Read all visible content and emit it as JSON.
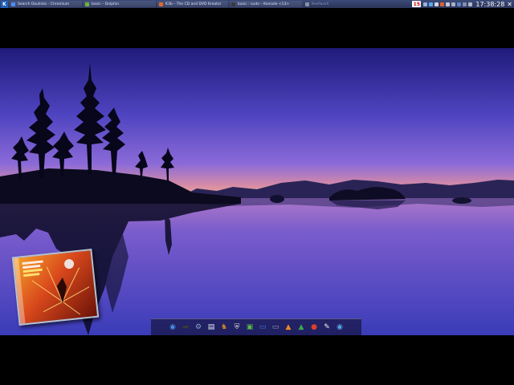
{
  "taskbar": {
    "tasks": [
      {
        "label": "Search Ooulinks - Chromium",
        "icon": "chromium-icon",
        "color": "#4b8cf0"
      },
      {
        "label": "basic – Dolphin",
        "icon": "dolphin-icon",
        "color": "#6fb23a"
      },
      {
        "label": "K3b – The CD and DVD Kreator",
        "icon": "k3b-icon",
        "color": "#e0682a"
      },
      {
        "label": "basic : sudo – Konsole <13>",
        "icon": "konsole-icon",
        "color": "#3a3a3a"
      },
      {
        "label": "KeePassX",
        "icon": "keepassx-icon",
        "color": "#8890a8"
      }
    ],
    "calendar_day": "15",
    "clock": "17:38:28",
    "close_glyph": "✕"
  },
  "colors": {
    "sky_top": "#1f1b7a",
    "sky_mid": "#6b5ad6",
    "horizon": "#e89a9c",
    "water": "#4b4ac4",
    "taskbar": "#2f3a62"
  },
  "dock": {
    "icons": [
      {
        "name": "chromium-icon",
        "glyph": "◉",
        "color": "#4a8fe8"
      },
      {
        "name": "sudo-terminal-icon",
        "glyph": "▬",
        "color": "#3a3a3a"
      },
      {
        "name": "settings-gear-icon",
        "glyph": "⚙",
        "color": "#8aa0c8"
      },
      {
        "name": "text-editor-icon",
        "glyph": "▤",
        "color": "#e8eef8"
      },
      {
        "name": "launcher-icon",
        "glyph": "♞",
        "color": "#c8842a"
      },
      {
        "name": "shield-icon",
        "glyph": "⛨",
        "color": "#d8dce8"
      },
      {
        "name": "image-viewer-icon",
        "glyph": "▣",
        "color": "#5cb84a"
      },
      {
        "name": "monitor-icon",
        "glyph": "▭",
        "color": "#4a7ad8"
      },
      {
        "name": "display-icon",
        "glyph": "▭",
        "color": "#9aa4b8"
      },
      {
        "name": "vlc-icon",
        "glyph": "▲",
        "color": "#f08a1a"
      },
      {
        "name": "photos-icon",
        "glyph": "▲",
        "color": "#3aa84a"
      },
      {
        "name": "media-player-icon",
        "glyph": "●",
        "color": "#d8402a"
      },
      {
        "name": "notes-icon",
        "glyph": "✎",
        "color": "#f0f0f0"
      },
      {
        "name": "disc-burner-icon",
        "glyph": "◉",
        "color": "#58a8e8"
      }
    ]
  }
}
